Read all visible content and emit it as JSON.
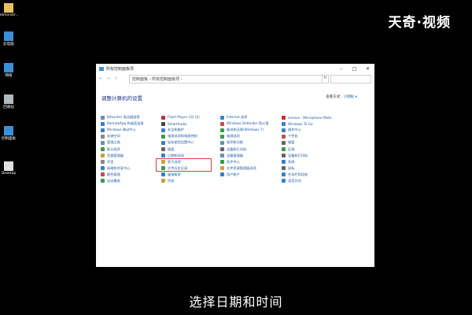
{
  "desktop": {
    "icons": [
      {
        "label": "Administr...",
        "icon": "user-folder-icon",
        "color": "#e8c060"
      },
      {
        "label": "此电脑",
        "icon": "computer-icon",
        "color": "#3a8fd8"
      },
      {
        "label": "网络",
        "icon": "network-icon",
        "color": "#3a8fd8"
      },
      {
        "label": "回收站",
        "icon": "recycle-bin-icon",
        "color": "#b0b8c0"
      },
      {
        "label": "控制面板",
        "icon": "control-panel-icon",
        "color": "#3a8fd8"
      },
      {
        "label": "Desktop",
        "icon": "file-icon",
        "color": "#e0e0e0"
      }
    ]
  },
  "watermark": "天奇·视频",
  "subtitle": "选择日期和时间",
  "window": {
    "title": "所有控制面板项",
    "controls": {
      "minimize": "–",
      "maximize": "□",
      "close": "✕"
    },
    "address": {
      "nav": "← → ↑",
      "path": "控制面板 › 所有控制面板项 ›",
      "refresh": "↻"
    },
    "heading": "调整计算机的设置",
    "view_by_label": "查看方式:",
    "view_by_value": "小图标 ▾"
  },
  "columns": [
    [
      {
        "label": "BitLocker 驱动器加密",
        "color": "#6a8fb0"
      },
      {
        "label": "RemoteApp 和桌面连接",
        "color": "#3a7fc8"
      },
      {
        "label": "Windows 移动中心",
        "color": "#3a7fc8"
      },
      {
        "label": "存储空间",
        "color": "#888"
      },
      {
        "label": "管理工具",
        "color": "#6a8fb0"
      },
      {
        "label": "默认程序",
        "color": "#3a9a4a"
      },
      {
        "label": "凭据管理器",
        "color": "#c8a040"
      },
      {
        "label": "声音",
        "color": "#888"
      },
      {
        "label": "网络和共享中心",
        "color": "#3a7fc8"
      },
      {
        "label": "颜色管理",
        "color": "#c05050"
      },
      {
        "label": "自动播放",
        "color": "#3a9a4a"
      }
    ],
    [
      {
        "label": "Flash Player (32 位)",
        "color": "#c03030"
      },
      {
        "label": "SmartAudio",
        "color": "#444"
      },
      {
        "label": "安全和维护",
        "color": "#3a7fc8"
      },
      {
        "label": "电源选项和电源控制",
        "color": "#3a9a4a"
      },
      {
        "label": "轻松使用设置中心",
        "color": "#3a7fc8"
      },
      {
        "label": "键盘",
        "color": "#666"
      },
      {
        "label": "日期和时间",
        "color": "#3a7fc8"
      },
      {
        "label": "索引选项",
        "color": "#c8a040"
      },
      {
        "label": "文件历史记录",
        "color": "#3a9a4a"
      },
      {
        "label": "疑难解答",
        "color": "#3a7fc8"
      },
      {
        "label": "字体",
        "color": "#c8a040"
      }
    ],
    [
      {
        "label": "Internet 选项",
        "color": "#3a7fc8"
      },
      {
        "label": "Windows Defender 防火墙",
        "color": "#c05050"
      },
      {
        "label": "备份和还原(Windows 7)",
        "color": "#3a9a4a"
      },
      {
        "label": "电源选项",
        "color": "#3a9a4a"
      },
      {
        "label": "程序和功能",
        "color": "#6a8fb0"
      },
      {
        "label": "设备和打印机",
        "color": "#666"
      },
      {
        "label": "设备管理器",
        "color": "#6a8fb0"
      },
      {
        "label": "同步中心",
        "color": "#3a9a4a"
      },
      {
        "label": "文件资源管理器选项",
        "color": "#c8a040"
      },
      {
        "label": "用户帐户",
        "color": "#3a7fc8"
      },
      {
        "label": "",
        "color": "#ffffff"
      }
    ],
    [
      {
        "label": "Lenovo - Microphone Mute",
        "color": "#c03030"
      },
      {
        "label": "Windows To Go",
        "color": "#3a7fc8"
      },
      {
        "label": "操作中心",
        "color": "#3a7fc8"
      },
      {
        "label": "个性化",
        "color": "#c05050"
      },
      {
        "label": "键盘",
        "color": "#666"
      },
      {
        "label": "区域",
        "color": "#3a9a4a"
      },
      {
        "label": "设备和打印机",
        "color": "#666"
      },
      {
        "label": "系统",
        "color": "#3a7fc8"
      },
      {
        "label": "鼠标",
        "color": "#666"
      },
      {
        "label": "任务栏和导航",
        "color": "#3a7fc8"
      },
      {
        "label": "语音识别",
        "color": "#3a7fc8"
      }
    ]
  ]
}
